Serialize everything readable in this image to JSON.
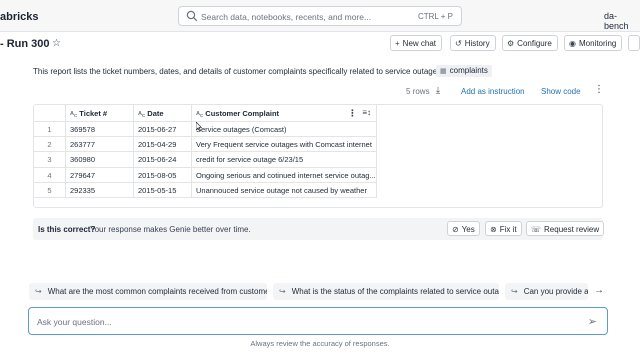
{
  "topbar": {
    "brand": "abricks",
    "search_placeholder": "Search data, notebooks, recents, and more...",
    "search_shortcut": "CTRL + P",
    "user": "da-bench"
  },
  "page": {
    "title": "- Run 300",
    "star_icon": "star-outline-icon",
    "buttons": [
      {
        "label": "New chat",
        "icon": "+"
      },
      {
        "label": "History",
        "icon": "history-icon"
      },
      {
        "label": "Configure",
        "icon": "gear-icon"
      },
      {
        "label": "Monitoring",
        "icon": "eye-icon"
      }
    ]
  },
  "response": {
    "description": "This report lists the ticket numbers, dates, and details of customer complaints specifically related to service outages.",
    "table_chip": "complaints",
    "row_count": "5 rows",
    "add_instruction": "Add as instruction",
    "show_code": "Show code"
  },
  "table": {
    "columns": [
      "Ticket #",
      "Date",
      "Customer Complaint"
    ],
    "rows": [
      {
        "n": "1",
        "ticket": "369578",
        "date": "2015-06-27",
        "complaint": "Service outages (Comcast)"
      },
      {
        "n": "2",
        "ticket": "263777",
        "date": "2015-04-29",
        "complaint": "Very Frequent service outages with Comcast internet"
      },
      {
        "n": "3",
        "ticket": "360980",
        "date": "2015-06-24",
        "complaint": "credit for service outage 6/23/15"
      },
      {
        "n": "4",
        "ticket": "279647",
        "date": "2015-08-05",
        "complaint": "Ongoing serious and cotinued internet service outag..."
      },
      {
        "n": "5",
        "ticket": "292335",
        "date": "2015-05-15",
        "complaint": "Unannouced service outage not caused by weather"
      }
    ]
  },
  "feedback": {
    "question": "Is this correct?",
    "text": "Your response makes Genie better over time.",
    "yes": "Yes",
    "fix": "Fix it",
    "review": "Request review"
  },
  "suggestions": [
    "What are the most common complaints received from customers?",
    "What is the status of the complaints related to service outages?",
    "Can you provide a b"
  ],
  "input": {
    "placeholder": "Ask your question...",
    "footer": "Always review the accuracy of responses."
  }
}
